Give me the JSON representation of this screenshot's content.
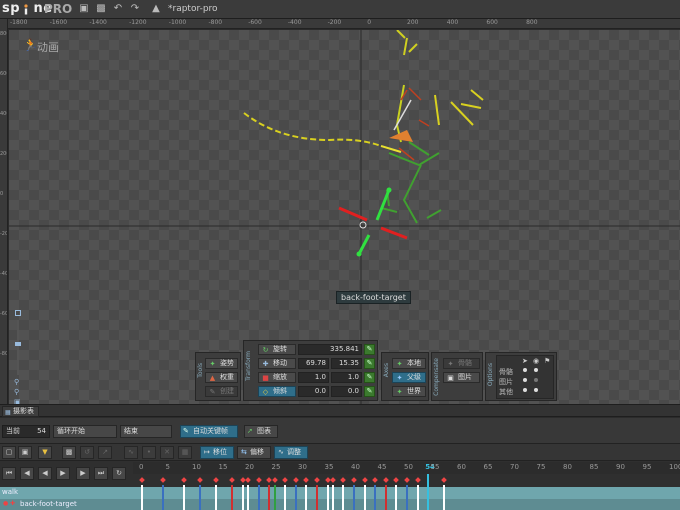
{
  "app": {
    "logo": "sp ne",
    "logo_pro": "PRO",
    "project_title": "*raptor-pro"
  },
  "ruler_top_labels": [
    "-1800",
    "-1600",
    "-1400",
    "-1200",
    "-1000",
    "-800",
    "-600",
    "-400",
    "-200",
    "0",
    "200",
    "400",
    "600",
    "800"
  ],
  "ruler_left_labels": [
    "800",
    "600",
    "400",
    "200",
    "0",
    "-200",
    "-400",
    "-600",
    "-800"
  ],
  "viewport": {
    "mode_label": "动画",
    "selected_bone": "back-foot-target"
  },
  "tools": {
    "title": "Tools",
    "pose": "姿势",
    "weights": "权重",
    "create": "创建"
  },
  "transform": {
    "title": "Transform",
    "rotate": {
      "label": "旋转",
      "value": "335.841"
    },
    "translate": {
      "label": "移动",
      "x": "69.78",
      "y": "15.35"
    },
    "scale": {
      "label": "缩放",
      "x": "1.0",
      "y": "1.0"
    },
    "shear": {
      "label": "倾斜",
      "x": "0.0",
      "y": "0.0"
    }
  },
  "axes": {
    "title": "Axes",
    "local": "本地",
    "parent": "父级",
    "world": "世界"
  },
  "compensate": {
    "title": "Compensate",
    "bones": "骨骼",
    "images": "图片"
  },
  "options": {
    "title": "Options",
    "rows": [
      "骨骼",
      "图片",
      "其他"
    ]
  },
  "dopesheet": {
    "tab": "摄影表",
    "current_label": "当前",
    "current_frame": "54",
    "loop_start": "循环开始",
    "end_label": "结束",
    "autokey": "自动关键帧",
    "graph": "图表",
    "move_filter": "移位",
    "offset": "偏移",
    "adjust": "调整",
    "tracks": [
      "walk",
      "back-foot-target"
    ],
    "frame_numbers": [
      "0",
      "5",
      "10",
      "15",
      "20",
      "25",
      "30",
      "35",
      "40",
      "45",
      "50",
      "54",
      "55",
      "60",
      "65",
      "70",
      "75",
      "80",
      "85",
      "90",
      "95",
      "100"
    ]
  },
  "colors": {
    "accent": "#2f6e8a",
    "key_green": "#3b7a2e",
    "track_walk": "#6fa6ad",
    "playhead": "#35c0e0"
  }
}
